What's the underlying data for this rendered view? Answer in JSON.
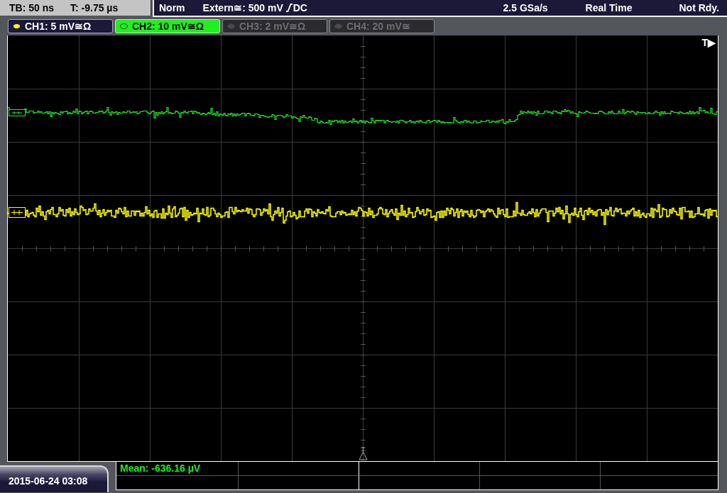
{
  "timebase": {
    "scale": "TB: 50 ns",
    "position": "T: -9.75 µs"
  },
  "trigger": {
    "mode": "Norm",
    "source": "Extern≅: 500 mV",
    "slope": {
      "kind": "rising"
    },
    "coupling": "DC"
  },
  "acquisition": {
    "sample_rate": "2.5 GSa/s",
    "mode": "Real Time",
    "status": "Not Rdy."
  },
  "channels": [
    {
      "label": "CH1: 5 mV≅Ω",
      "enabled": true,
      "selected": false,
      "color": "#ffff00"
    },
    {
      "label": "CH2: 10 mV≅Ω",
      "enabled": true,
      "selected": true,
      "color": "#22ee22"
    },
    {
      "label": "CH3: 2 mV≅Ω",
      "enabled": false,
      "selected": false
    },
    {
      "label": "CH4: 20 mV≅",
      "enabled": false,
      "selected": false
    }
  ],
  "plot": {
    "trigger_marker": "T▶"
  },
  "measurements": [
    {
      "text": "Mean: -636.16 µV"
    }
  ],
  "datetime": "2015-06-24 03:08"
}
